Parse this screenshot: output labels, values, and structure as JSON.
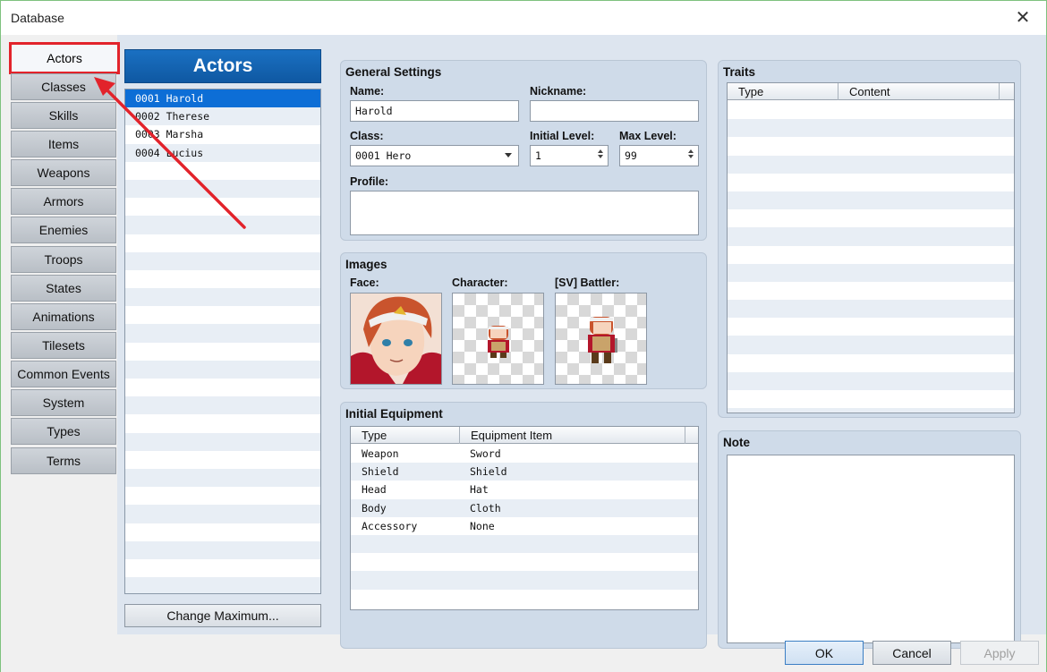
{
  "window": {
    "title": "Database",
    "close_glyph": "✕"
  },
  "nav": {
    "items": [
      {
        "label": "Actors",
        "active": true
      },
      {
        "label": "Classes"
      },
      {
        "label": "Skills"
      },
      {
        "label": "Items"
      },
      {
        "label": "Weapons"
      },
      {
        "label": "Armors"
      },
      {
        "label": "Enemies"
      },
      {
        "label": "Troops"
      },
      {
        "label": "States"
      },
      {
        "label": "Animations"
      },
      {
        "label": "Tilesets"
      },
      {
        "label": "Common Events"
      },
      {
        "label": "System"
      },
      {
        "label": "Types"
      },
      {
        "label": "Terms"
      }
    ]
  },
  "actors_panel": {
    "header": "Actors",
    "items": [
      "0001 Harold",
      "0002 Therese",
      "0003 Marsha",
      "0004 Lucius"
    ],
    "selected_index": 0,
    "change_max_label": "Change Maximum..."
  },
  "general": {
    "title": "General Settings",
    "name_label": "Name:",
    "name_value": "Harold",
    "nickname_label": "Nickname:",
    "nickname_value": "",
    "class_label": "Class:",
    "class_value": "0001 Hero",
    "initial_level_label": "Initial Level:",
    "initial_level_value": "1",
    "max_level_label": "Max Level:",
    "max_level_value": "99",
    "profile_label": "Profile:",
    "profile_value": ""
  },
  "images": {
    "title": "Images",
    "face_label": "Face:",
    "character_label": "Character:",
    "battler_label": "[SV] Battler:"
  },
  "equipment": {
    "title": "Initial Equipment",
    "columns": [
      "Type",
      "Equipment Item"
    ],
    "rows": [
      [
        "Weapon",
        "Sword"
      ],
      [
        "Shield",
        "Shield"
      ],
      [
        "Head",
        "Hat"
      ],
      [
        "Body",
        "Cloth"
      ],
      [
        "Accessory",
        "None"
      ]
    ]
  },
  "traits": {
    "title": "Traits",
    "columns": [
      "Type",
      "Content"
    ]
  },
  "note": {
    "title": "Note",
    "value": ""
  },
  "footer": {
    "ok_label": "OK",
    "cancel_label": "Cancel",
    "apply_label": "Apply"
  },
  "colors": {
    "highlight_red": "#e2232b",
    "accent_blue": "#0f58a2",
    "selection_blue": "#0d6ed6"
  }
}
